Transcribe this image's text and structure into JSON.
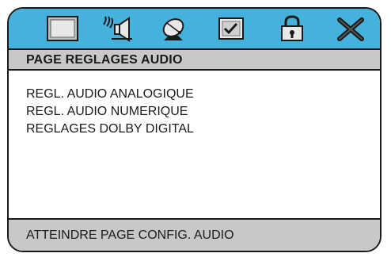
{
  "toolbar": {
    "icons": [
      {
        "name": "general-setup-icon"
      },
      {
        "name": "audio-setup-icon"
      },
      {
        "name": "video-setup-icon"
      },
      {
        "name": "preference-icon"
      },
      {
        "name": "password-lock-icon"
      },
      {
        "name": "exit-icon"
      }
    ],
    "accent_color": "#45b2de"
  },
  "header": {
    "title": "PAGE REGLAGES AUDIO"
  },
  "menu": {
    "items": [
      {
        "label": "REGL. AUDIO ANALOGIQUE"
      },
      {
        "label": "REGL. AUDIO NUMERIQUE"
      },
      {
        "label": "REGLAGES DOLBY DIGITAL"
      }
    ]
  },
  "status": {
    "text": "ATTEINDRE PAGE CONFIG. AUDIO"
  }
}
